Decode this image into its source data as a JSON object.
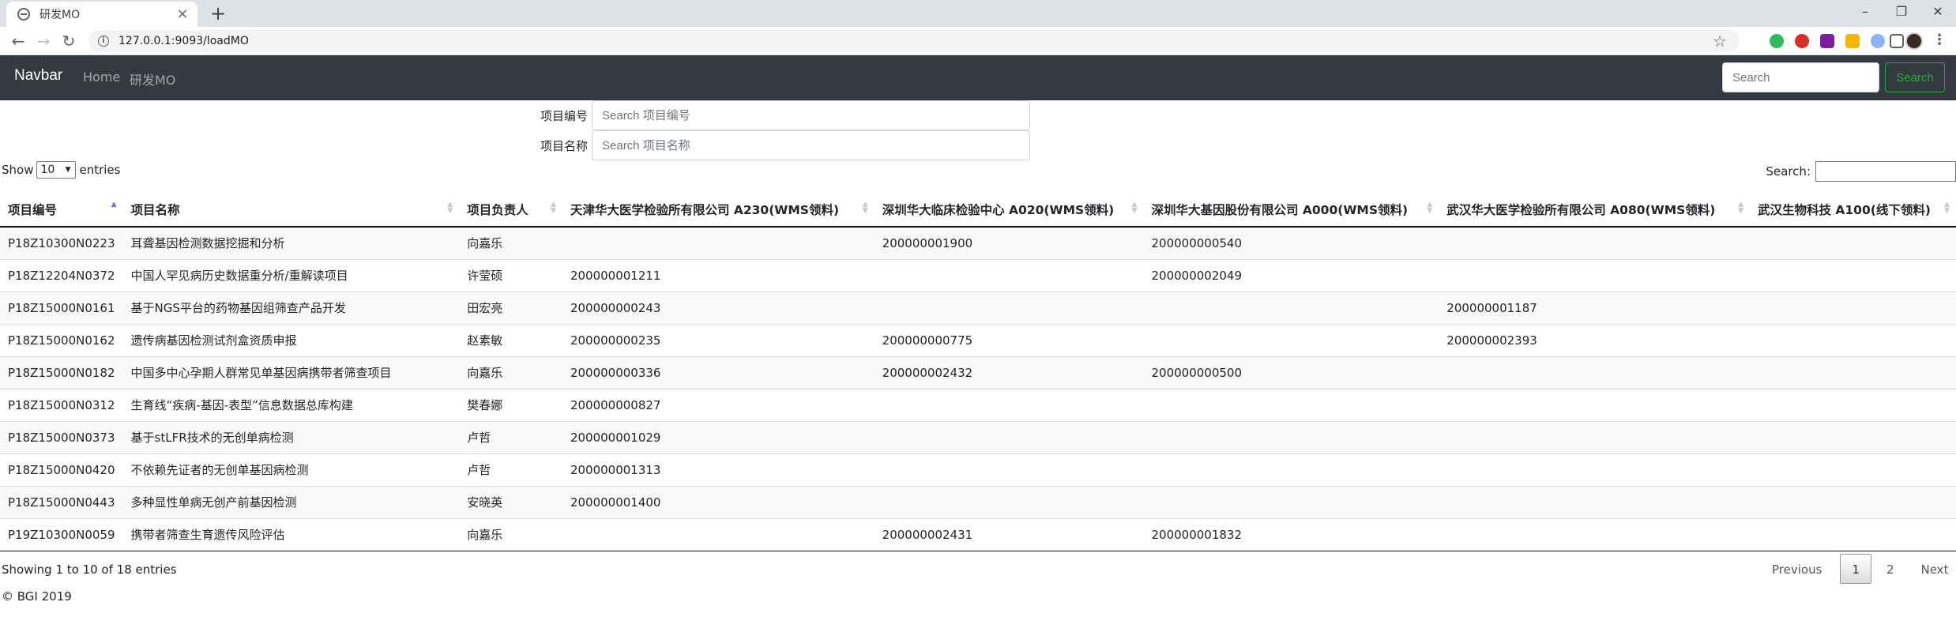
{
  "browser": {
    "tab_title": "研发MO",
    "tab_close": "×",
    "new_tab": "+",
    "url": "127.0.0.1:9093/loadMO",
    "win_min": "–",
    "win_max": "❐",
    "win_close": "✕"
  },
  "navbar": {
    "brand": "Navbar",
    "links": [
      "Home",
      "研发MO"
    ],
    "search_placeholder": "Search",
    "search_button": "Search"
  },
  "filters": [
    {
      "label": "项目编号",
      "placeholder": "Search 项目编号"
    },
    {
      "label": "项目名称",
      "placeholder": "Search 项目名称"
    }
  ],
  "length": {
    "show": "Show",
    "value": "10",
    "entries": "entries"
  },
  "search_label": "Search:",
  "table": {
    "columns": [
      "项目编号",
      "项目名称",
      "项目负责人",
      "天津华大医学检验所有限公司 A230(WMS领料)",
      "深圳华大临床检验中心 A020(WMS领料)",
      "深圳华大基因股份有限公司 A000(WMS领料)",
      "武汉华大医学检验所有限公司 A080(WMS领料)",
      "武汉生物科技 A100(线下领料)"
    ],
    "rows": [
      [
        "P18Z10300N0223",
        "耳聋基因检测数据挖掘和分析",
        "向嘉乐",
        "",
        "200000001900",
        "200000000540",
        "",
        ""
      ],
      [
        "P18Z12204N0372",
        "中国人罕见病历史数据重分析/重解读项目",
        "许莹硕",
        "200000001211",
        "",
        "200000002049",
        "",
        ""
      ],
      [
        "P18Z15000N0161",
        "基于NGS平台的药物基因组筛查产品开发",
        "田宏亮",
        "200000000243",
        "",
        "",
        "200000001187",
        ""
      ],
      [
        "P18Z15000N0162",
        "遗传病基因检测试剂盒资质申报",
        "赵素敏",
        "200000000235",
        "200000000775",
        "",
        "200000002393",
        ""
      ],
      [
        "P18Z15000N0182",
        "中国多中心孕期人群常见单基因病携带者筛查项目",
        "向嘉乐",
        "200000000336",
        "200000002432",
        "200000000500",
        "",
        ""
      ],
      [
        "P18Z15000N0312",
        "生育线“疾病-基因-表型”信息数据总库构建",
        "樊春娜",
        "200000000827",
        "",
        "",
        "",
        ""
      ],
      [
        "P18Z15000N0373",
        "基于stLFR技术的无创单病检测",
        "卢哲",
        "200000001029",
        "",
        "",
        "",
        ""
      ],
      [
        "P18Z15000N0420",
        "不依赖先证者的无创单基因病检测",
        "卢哲",
        "200000001313",
        "",
        "",
        "",
        ""
      ],
      [
        "P18Z15000N0443",
        "多种显性单病无创产前基因检测",
        "安晓英",
        "200000001400",
        "",
        "",
        "",
        ""
      ],
      [
        "P19Z10300N0059",
        "携带者筛查生育遗传风险评估",
        "向嘉乐",
        "",
        "200000002431",
        "200000001832",
        "",
        ""
      ]
    ]
  },
  "info": "Showing 1 to 10 of 18 entries",
  "pagination": {
    "previous": "Previous",
    "pages": [
      "1",
      "2"
    ],
    "next": "Next"
  },
  "footer": "© BGI 2019"
}
